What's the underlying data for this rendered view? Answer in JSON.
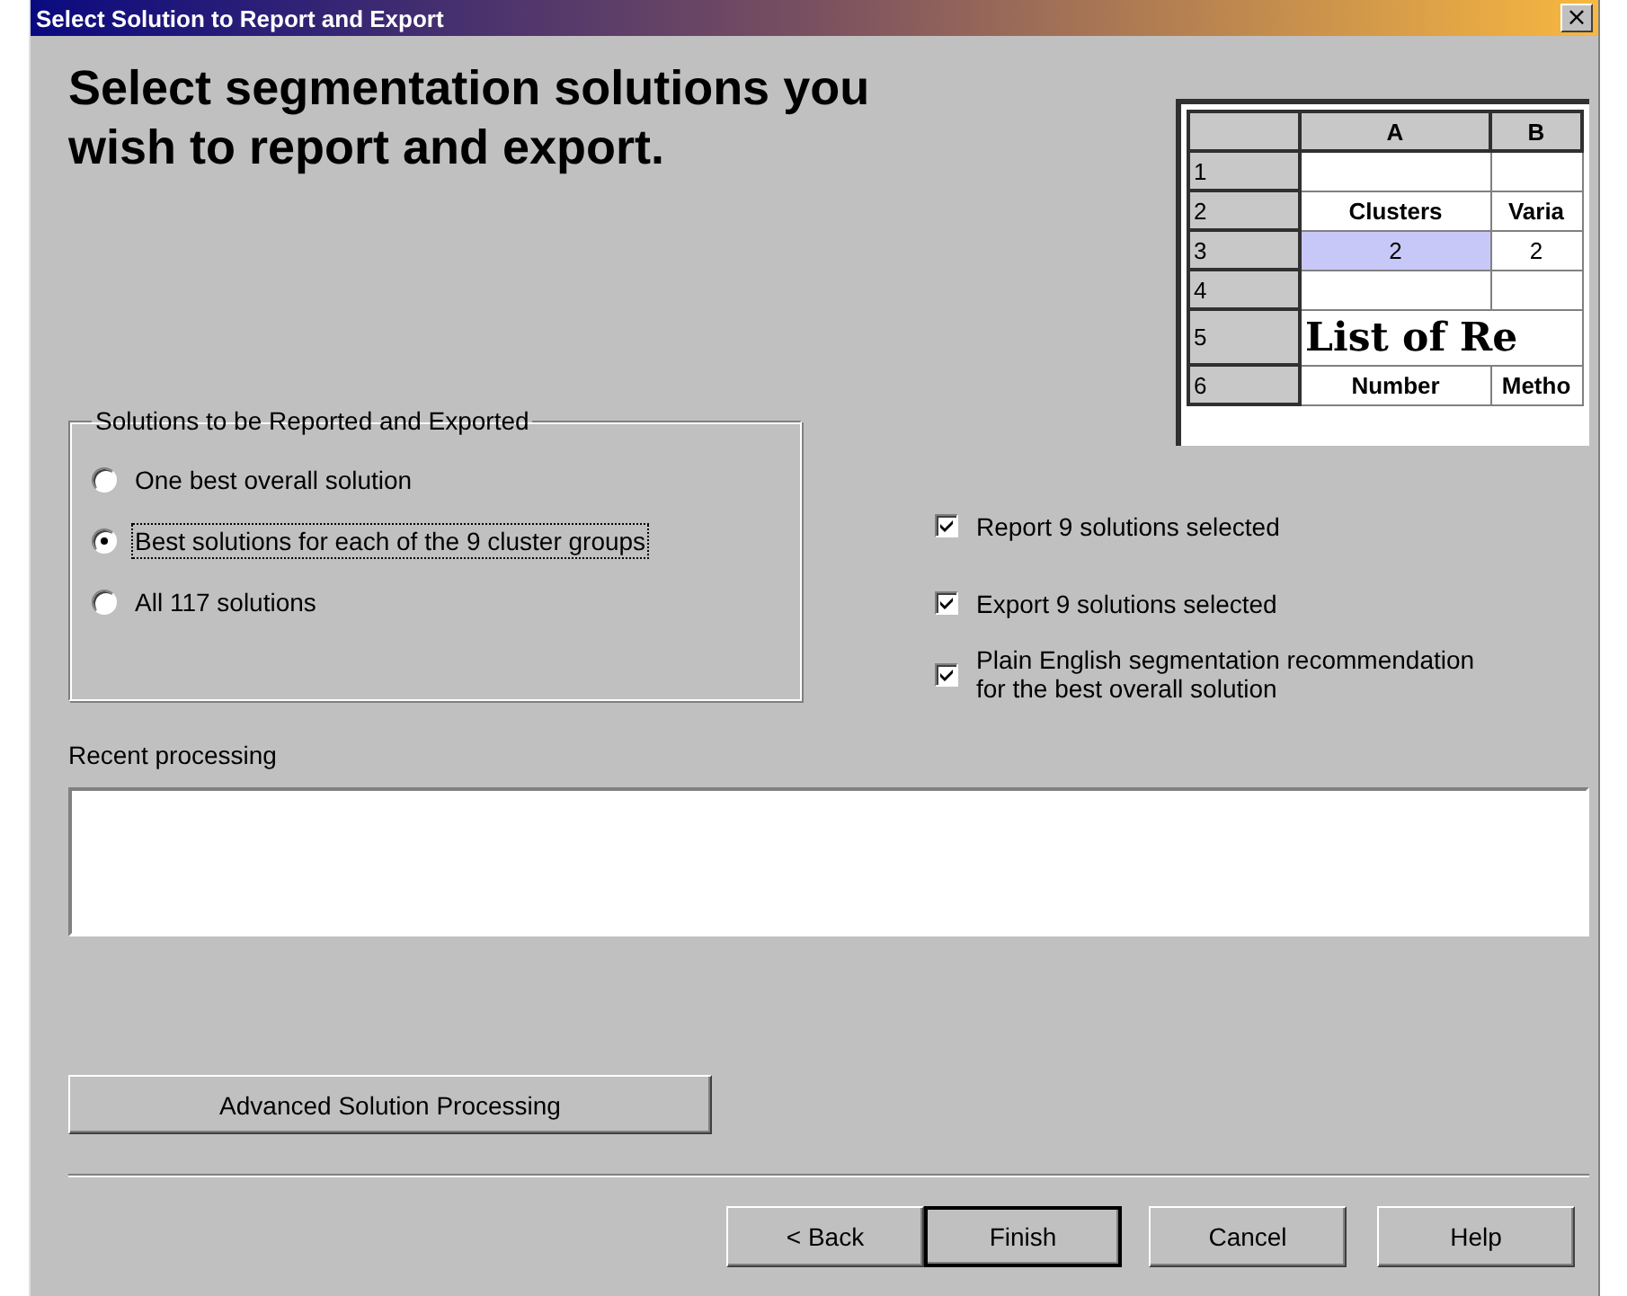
{
  "window": {
    "title": "Select Solution to Report and Export",
    "close": "×"
  },
  "heading": "Select segmentation solutions you wish to report and export.",
  "spreadsheet": {
    "columns": [
      "A",
      "B"
    ],
    "rows": [
      {
        "header": "1",
        "cells": [
          {
            "text": "",
            "selected": false
          },
          {
            "text": "",
            "selected": false
          }
        ],
        "kind": "plain"
      },
      {
        "header": "2",
        "cells": [
          {
            "text": "Clusters",
            "selected": false
          },
          {
            "text": "Varia",
            "selected": false
          }
        ],
        "kind": "label"
      },
      {
        "header": "3",
        "cells": [
          {
            "text": "2",
            "selected": true
          },
          {
            "text": "2",
            "selected": false
          }
        ],
        "kind": "plain"
      },
      {
        "header": "4",
        "cells": [
          {
            "text": "",
            "selected": false
          },
          {
            "text": "",
            "selected": false
          }
        ],
        "kind": "plain"
      },
      {
        "header": "5",
        "cells": [
          {
            "text": "List of Re",
            "selected": false,
            "colspan": 2
          }
        ],
        "kind": "title"
      },
      {
        "header": "6",
        "cells": [
          {
            "text": "Number",
            "selected": false
          },
          {
            "text": "Metho",
            "selected": false
          }
        ],
        "kind": "label"
      }
    ]
  },
  "solutions_group": {
    "title": "Solutions to be Reported and Exported",
    "options": [
      {
        "label": "One best overall solution",
        "selected": false
      },
      {
        "label": "Best solutions for each of the 9 cluster groups",
        "selected": true
      },
      {
        "label": "All 117 solutions",
        "selected": false
      }
    ]
  },
  "checkboxes": [
    {
      "label": "Report 9 solutions selected",
      "checked": true
    },
    {
      "label": "Export 9 solutions selected",
      "checked": true
    },
    {
      "label": "Plain English segmentation recommendation\nfor the best overall solution",
      "checked": true
    }
  ],
  "recent_processing": {
    "label": "Recent processing"
  },
  "advanced_button": "Advanced Solution Processing",
  "buttons": [
    {
      "label": "< Back",
      "default": false
    },
    {
      "label": "Finish",
      "default": true
    },
    {
      "label": "Cancel",
      "default": false
    },
    {
      "label": "Help",
      "default": false
    }
  ]
}
